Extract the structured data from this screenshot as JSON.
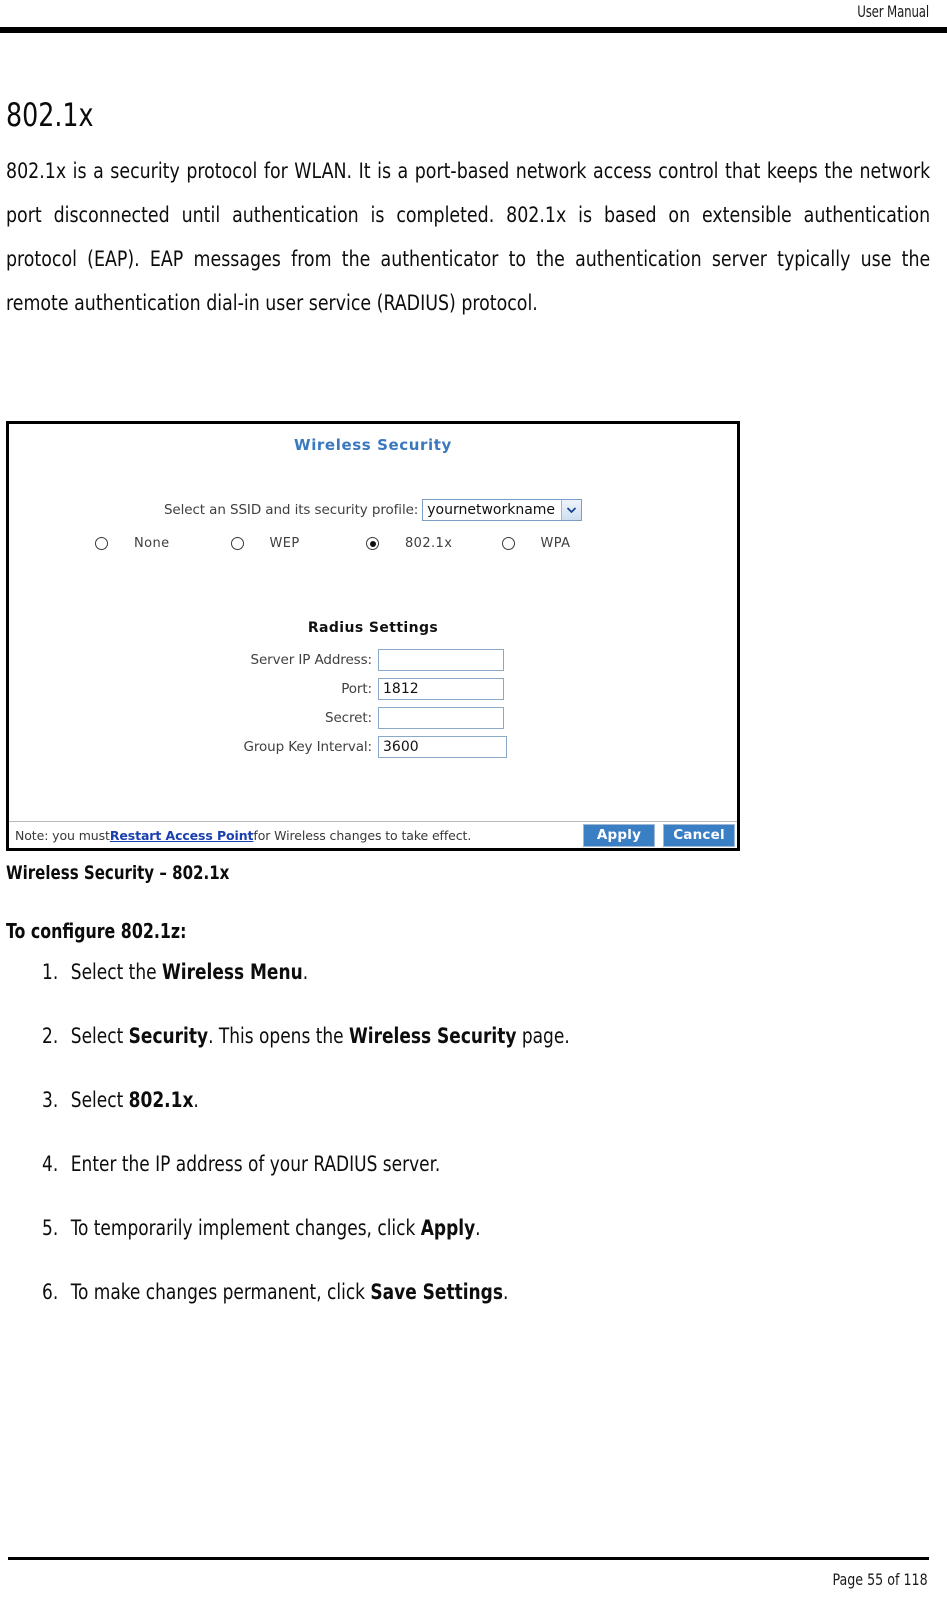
{
  "header": {
    "title": "User Manual"
  },
  "section": {
    "heading": "802.1x",
    "paragraph": "802.1x is a security protocol for WLAN. It is a port-based network access control that keeps the network port disconnected until authentication is completed. 802.1x is based on extensible authentication protocol (EAP). EAP messages from the authenticator to the authentication server typically use the remote authentication dial-in user service (RADIUS) protocol."
  },
  "screenshot": {
    "title": "Wireless Security",
    "ssid": {
      "label": "Select an SSID and its security profile:",
      "selected_value": "yournetworkname",
      "arrow_icon": "chevron-down-icon"
    },
    "security_modes": [
      {
        "label": "None",
        "checked": false
      },
      {
        "label": "WEP",
        "checked": false
      },
      {
        "label": "802.1x",
        "checked": true
      },
      {
        "label": "WPA",
        "checked": false
      }
    ],
    "radius": {
      "title": "Radius Settings",
      "fields": [
        {
          "label": "Server IP Address:",
          "value": ""
        },
        {
          "label": "Port:",
          "value": "1812"
        },
        {
          "label": "Secret:",
          "value": ""
        },
        {
          "label": "Group Key Interval:",
          "value": "3600"
        }
      ]
    },
    "note": {
      "prefix": "Note: you must ",
      "link": "Restart Access Point",
      "suffix": " for Wireless changes to take effect."
    },
    "buttons": {
      "apply": "Apply",
      "cancel": "Cancel"
    },
    "colors": {
      "title_blue": "#3A78C0",
      "button_blue": "#3A7EC4",
      "link_blue": "#1A3FAE",
      "field_border": "#8AA8C8"
    }
  },
  "figure_caption": "Wireless Security – 802.1x",
  "procedure": {
    "title": "To configure 802.1z:",
    "steps": [
      {
        "num": "1.",
        "parts": [
          {
            "t": "Select the ",
            "b": false
          },
          {
            "t": "Wireless Menu",
            "b": true
          },
          {
            "t": ".",
            "b": false
          }
        ]
      },
      {
        "num": "2.",
        "parts": [
          {
            "t": "Select ",
            "b": false
          },
          {
            "t": "Security",
            "b": true
          },
          {
            "t": ". This opens the ",
            "b": false
          },
          {
            "t": "Wireless Security",
            "b": true
          },
          {
            "t": " page.",
            "b": false
          }
        ]
      },
      {
        "num": "3.",
        "parts": [
          {
            "t": "Select ",
            "b": false
          },
          {
            "t": "802.1x",
            "b": true
          },
          {
            "t": ".",
            "b": false
          }
        ]
      },
      {
        "num": "4.",
        "parts": [
          {
            "t": "Enter the IP address of your RADIUS server.",
            "b": false
          }
        ]
      },
      {
        "num": "5.",
        "parts": [
          {
            "t": "To temporarily implement changes, click ",
            "b": false
          },
          {
            "t": "Apply",
            "b": true
          },
          {
            "t": ".",
            "b": false
          }
        ]
      },
      {
        "num": "6.",
        "parts": [
          {
            "t": "To make changes permanent, click ",
            "b": false
          },
          {
            "t": "Save Settings",
            "b": true
          },
          {
            "t": ".",
            "b": false
          }
        ]
      }
    ]
  },
  "footer": {
    "page_text": "Page 55 of 118"
  }
}
